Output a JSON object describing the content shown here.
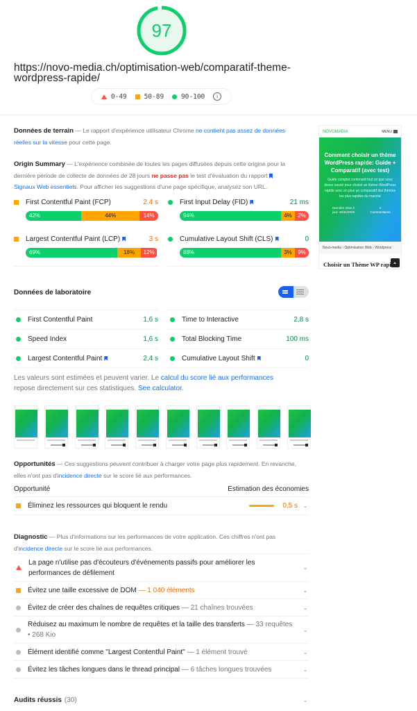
{
  "score": {
    "value": "97",
    "fraction": 0.97,
    "color": "#0cce6b"
  },
  "url": "https://novo-media.ch/optimisation-web/comparatif-theme-wordpress-rapide/",
  "legend": {
    "fail": "0-49",
    "average": "50-89",
    "pass": "90-100"
  },
  "field": {
    "title": "Données de terrain",
    "text_before": " — Le rapport d'expérience utilisateur Chrome ",
    "link": "ne contient pas assez de données réelles sur la vitesse",
    "text_after": " pour cette page."
  },
  "origin": {
    "title": "Origin Summary",
    "text_before": " — L'expérience combinée de toutes les pages diffusées depuis cette origine pour la dernière période de collecte de données de 28 jours ",
    "highlight": "ne passe pas",
    "text_mid": " le test d'évaluation du rapport ",
    "link": "Signaux Web essentiels",
    "text_after": ". Pour afficher les suggestions d'une page spécifique, analysez son URL.",
    "metrics": [
      {
        "label": "First Contentful Paint (FCP)",
        "value": "2.4 s",
        "status": "average",
        "bookmark": false,
        "dist": [
          42,
          44,
          14
        ],
        "dist_labels": [
          "42%",
          "44%",
          "14%"
        ]
      },
      {
        "label": "First Input Delay (FID)",
        "value": "21 ms",
        "status": "pass",
        "bookmark": true,
        "dist": [
          94,
          4,
          2
        ],
        "dist_labels": [
          "94%",
          "4%",
          "2%"
        ]
      },
      {
        "label": "Largest Contentful Paint (LCP)",
        "value": "3 s",
        "status": "average",
        "bookmark": true,
        "dist": [
          69,
          18,
          12
        ],
        "dist_labels": [
          "69%",
          "18%",
          "12%"
        ]
      },
      {
        "label": "Cumulative Layout Shift (CLS)",
        "value": "0",
        "status": "pass",
        "bookmark": true,
        "dist": [
          88,
          3,
          9
        ],
        "dist_labels": [
          "88%",
          "3%",
          "9%"
        ]
      }
    ]
  },
  "thumbnail": {
    "brand": "NOVOMADIA",
    "menu": "MENU",
    "hero_title": "Comment choisir un thème WordPress rapide: Guide + Comparatif (avec test)",
    "hero_desc": "Guide complet contenant tout ce que vous devez savoir pour choisir un thème WordPress rapide avec en plus un comparatif des thèmes les plus rapides du marché",
    "meta_left": "Dernière mise à jour: 26/11/2020",
    "meta_right": "4 Commentaires",
    "breadcrumb": "Novo-media › Optimisation Web › Wordpress",
    "heading": "Choisir un Thème WP rapide"
  },
  "lab": {
    "title": "Données de laboratoire",
    "metrics": [
      {
        "label": "First Contentful Paint",
        "value": "1,6 s",
        "bookmark": false
      },
      {
        "label": "Time to Interactive",
        "value": "2,8 s",
        "bookmark": false
      },
      {
        "label": "Speed Index",
        "value": "1,6 s",
        "bookmark": false
      },
      {
        "label": "Total Blocking Time",
        "value": "100 ms",
        "bookmark": false
      },
      {
        "label": "Largest Contentful Paint",
        "value": "2,4 s",
        "bookmark": true
      },
      {
        "label": "Cumulative Layout Shift",
        "value": "0",
        "bookmark": true
      }
    ],
    "note_before": "Les valeurs sont estimées et peuvent varier. Le ",
    "note_link": "calcul du score lié aux performances",
    "note_mid": " repose directement sur ces statistiques. ",
    "note_link2": "See calculator."
  },
  "filmstrip": {
    "frames": 10
  },
  "opportunities": {
    "title": "Opportunités",
    "text_before": " — Ces suggestions peuvent contribuer à charger votre page plus rapidement. En revanche, elles n'ont pas d'",
    "link": "incidence directe",
    "text_after": " sur le score lié aux performances.",
    "col_left": "Opportunité",
    "col_right": "Estimation des économies",
    "items": [
      {
        "label": "Éliminez les ressources qui bloquent le rendu",
        "value": "0,5 s",
        "status": "average"
      }
    ]
  },
  "diagnostics": {
    "title": "Diagnostic",
    "text_before": " — Plus d'informations sur les performances de votre application. Ces chiffres n'ont pas d'",
    "link": "incidence directe",
    "text_after": " sur le score lié aux performances.",
    "items": [
      {
        "label": "La page n'utilise pas d'écouteurs d'événements passifs pour améliorer les performances de défilement",
        "detail": "",
        "status": "fail"
      },
      {
        "label": "Évitez une taille excessive de DOM",
        "detail": " — 1 040 éléments",
        "status": "average"
      },
      {
        "label": "Évitez de créer des chaînes de requêtes critiques",
        "detail": " — 21 chaînes trouvées",
        "status": "info"
      },
      {
        "label": "Réduisez au maximum le nombre de requêtes et la taille des transferts",
        "detail": " — 33 requêtes • 268 Kio",
        "status": "info"
      },
      {
        "label": "Élément identifié comme \"Largest Contentful Paint\"",
        "detail": " — 1 élément trouvé",
        "status": "info"
      },
      {
        "label": "Évitez les tâches longues dans le thread principal",
        "detail": " — 6 tâches longues trouvées",
        "status": "info"
      }
    ]
  },
  "passed": {
    "label": "Audits réussis",
    "count": "(30)"
  }
}
